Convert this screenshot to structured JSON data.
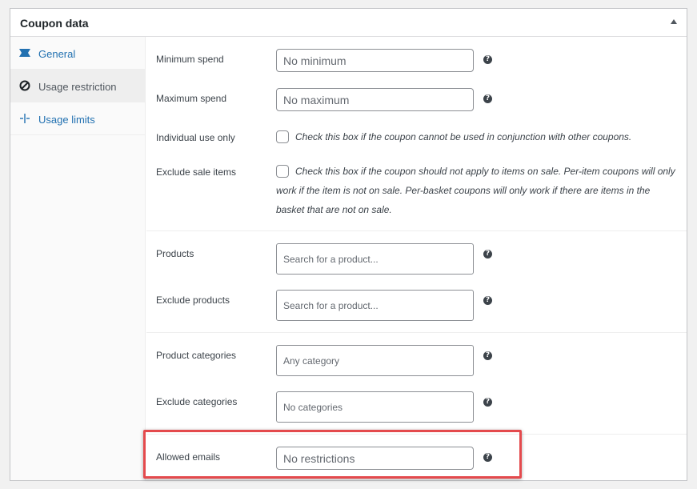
{
  "panel": {
    "title": "Coupon data"
  },
  "tabs": [
    {
      "label": "General",
      "icon": "ticket-icon",
      "active": false
    },
    {
      "label": "Usage restriction",
      "icon": "no-entry-icon",
      "active": true
    },
    {
      "label": "Usage limits",
      "icon": "crosshair-icon",
      "active": false
    }
  ],
  "fields": {
    "minimum_spend": {
      "label": "Minimum spend",
      "placeholder": "No minimum"
    },
    "maximum_spend": {
      "label": "Maximum spend",
      "placeholder": "No maximum"
    },
    "individual_use": {
      "label": "Individual use only",
      "description": "Check this box if the coupon cannot be used in conjunction with other coupons."
    },
    "exclude_sale": {
      "label": "Exclude sale items",
      "description": "Check this box if the coupon should not apply to items on sale. Per-item coupons will only work if the item is not on sale. Per-basket coupons will only work if there are items in the basket that are not on sale."
    },
    "products": {
      "label": "Products",
      "placeholder": "Search for a product..."
    },
    "exclude_products": {
      "label": "Exclude products",
      "placeholder": "Search for a product..."
    },
    "product_categories": {
      "label": "Product categories",
      "placeholder": "Any category"
    },
    "exclude_categories": {
      "label": "Exclude categories",
      "placeholder": "No categories"
    },
    "allowed_emails": {
      "label": "Allowed emails",
      "placeholder": "No restrictions"
    }
  },
  "help_glyph": "?",
  "colors": {
    "link": "#2271b1",
    "highlight": "#e44a4d"
  }
}
